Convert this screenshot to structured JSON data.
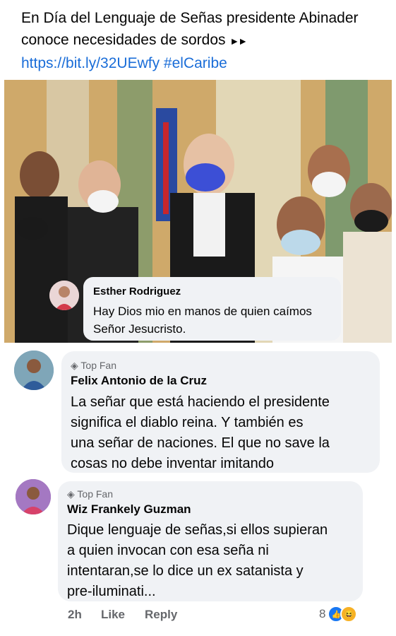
{
  "post": {
    "text": "En Día del Lenguaje de Señas presidente Abinader conoce necesidades de sordos",
    "arrows": "►►",
    "link": "https://bit.ly/32UEwfy",
    "hashtag": "#elCaribe"
  },
  "embedded_comment": {
    "author": "Esther Rodriguez",
    "text_line1": "Hay Dios mio en manos de quien caímos",
    "text_line2": "Señor Jesucristo."
  },
  "comments": [
    {
      "badge": "Top Fan",
      "author": "Felix Antonio de la Cruz",
      "lines": [
        "La señar que está haciendo el presidente",
        "significa el diablo reina. Y también es",
        "una señar de naciones. El que no save la",
        "cosas no debe inventar imitando"
      ]
    },
    {
      "badge": "Top Fan",
      "author": "Wiz Frankely Guzman",
      "lines": [
        "Dique lenguaje de señas,si ellos supieran",
        "a quien invocan con esa seña ni",
        "intentaran,se lo dice un ex satanista y",
        "pre-iluminati..."
      ]
    }
  ],
  "actions": {
    "time": "2h",
    "like": "Like",
    "reply": "Reply",
    "reactions_count": "8"
  },
  "colors": {
    "link": "#1a6dd8",
    "bubble": "#f0f2f5",
    "like_blue": "#1877f2",
    "haha_yellow": "#f7b125"
  }
}
